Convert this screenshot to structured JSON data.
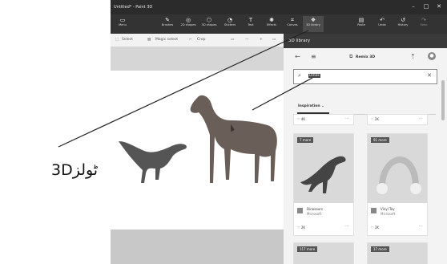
{
  "window": {
    "title": "Untitled* - Paint 3D",
    "controls": [
      "–",
      "□",
      "✕"
    ]
  },
  "toolbar": {
    "menu": "Menu",
    "items": [
      "Brushes",
      "2D shapes",
      "3D shapes",
      "Stickers",
      "Text",
      "Effects",
      "Canvas",
      "3D library",
      "Paste",
      "Undo",
      "History",
      "Redo"
    ]
  },
  "subbar": {
    "select": "Select",
    "magic_select": "Magic select",
    "crop": "Crop"
  },
  "panel": {
    "title": "3D library",
    "remix": "Remix 3D",
    "search_value": "Dinos",
    "section": "Inspiration",
    "top_likes": [
      "4K",
      "2K"
    ],
    "cards": [
      {
        "badge": "7 more",
        "name": "Dinosaurs",
        "author": "Microsoft",
        "likes": "2K"
      },
      {
        "badge": "91 more",
        "name": "Vinyl Toy",
        "author": "Microsoft",
        "likes": "2K"
      },
      {
        "badge": "117 more"
      },
      {
        "badge": "17 more"
      }
    ]
  },
  "callout": {
    "label": "3Dٹولز"
  }
}
